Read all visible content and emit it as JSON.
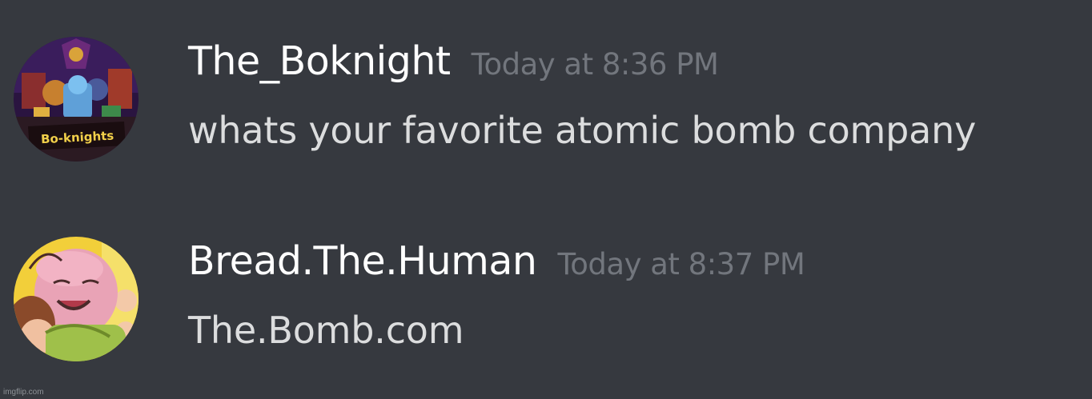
{
  "messages": [
    {
      "username": "The_Boknight",
      "timestamp": "Today at 8:36 PM",
      "content": "whats your favorite atomic bomb company",
      "avatar_text": "Bo-knights"
    },
    {
      "username": "Bread.The.Human",
      "timestamp": "Today at 8:37 PM",
      "content": "The.Bomb.com"
    }
  ],
  "watermark": "imgflip.com",
  "colors": {
    "background": "#36393f",
    "username": "#ffffff",
    "timestamp": "#72767d",
    "content": "#dcddde"
  }
}
